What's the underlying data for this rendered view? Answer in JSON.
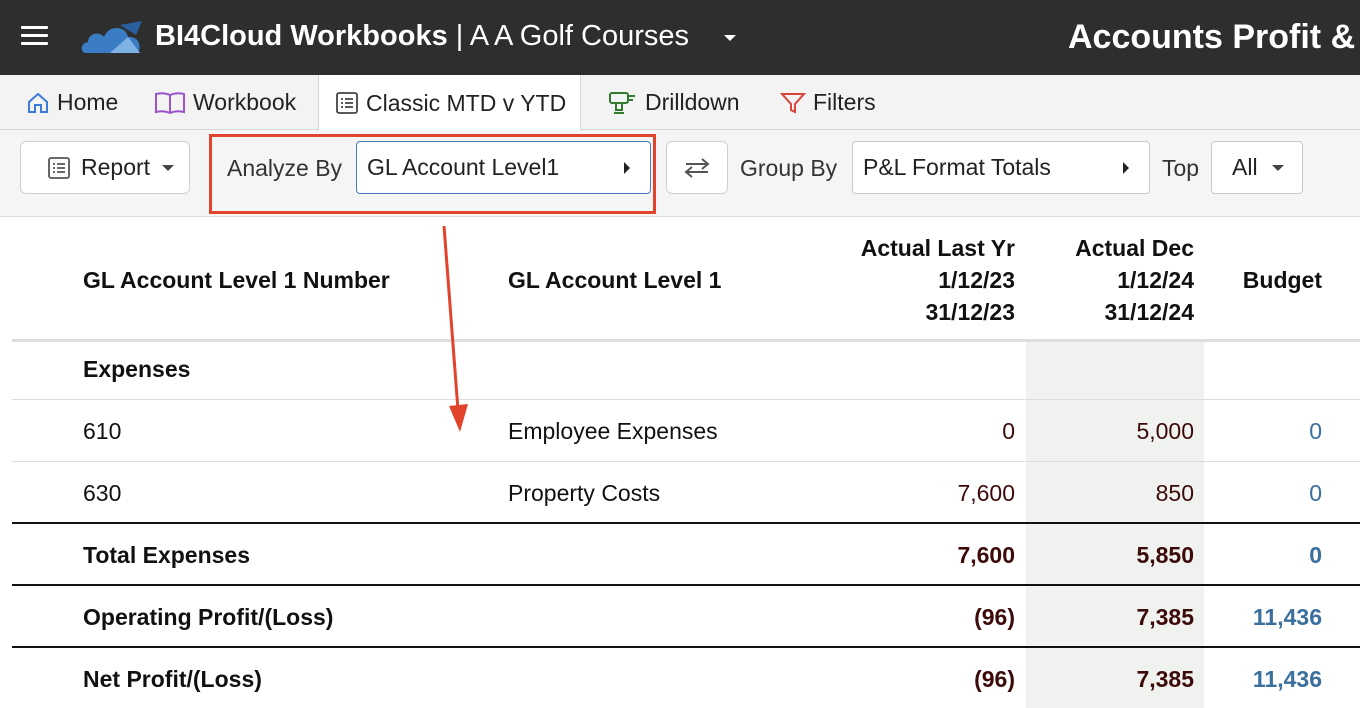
{
  "header": {
    "brand": "BI4Cloud Workbooks",
    "separator": " | ",
    "company": "A A Golf Courses",
    "report_title": "Accounts Profit &"
  },
  "tabs": [
    {
      "label": "Home",
      "icon": "home-icon"
    },
    {
      "label": "Workbook",
      "icon": "book-icon"
    },
    {
      "label": "Classic MTD v YTD",
      "icon": "list-icon"
    },
    {
      "label": "Drilldown",
      "icon": "drill-icon"
    },
    {
      "label": "Filters",
      "icon": "filter-icon"
    }
  ],
  "toolbar": {
    "report_label": "Report",
    "analyze_by_label": "Analyze By",
    "analyze_by_value": "GL Account Level1",
    "group_by_label": "Group By",
    "group_by_value": "P&L Format Totals",
    "top_label": "Top",
    "top_value": "All"
  },
  "table": {
    "headers": {
      "col1": "GL Account Level 1 Number",
      "col2": "GL Account Level 1",
      "col3_line1": "Actual Last Yr",
      "col3_line2": "1/12/23",
      "col3_line3": "31/12/23",
      "col4_line1": "Actual Dec",
      "col4_line2": "1/12/24",
      "col4_line3": "31/12/24",
      "col5": "Budget"
    },
    "rows": [
      {
        "number": "Expenses",
        "name": "",
        "last_yr": "",
        "actual_dec": "",
        "budget": ""
      },
      {
        "number": "610",
        "name": "Employee Expenses",
        "last_yr": "0",
        "actual_dec": "5,000",
        "budget": "0"
      },
      {
        "number": "630",
        "name": "Property Costs",
        "last_yr": "7,600",
        "actual_dec": "850",
        "budget": "0"
      },
      {
        "number": "Total Expenses",
        "name": "",
        "last_yr": "7,600",
        "actual_dec": "5,850",
        "budget": "0"
      },
      {
        "number": "Operating Profit/(Loss)",
        "name": "",
        "last_yr": "(96)",
        "actual_dec": "7,385",
        "budget": "11,436"
      },
      {
        "number": "Net Profit/(Loss)",
        "name": "",
        "last_yr": "(96)",
        "actual_dec": "7,385",
        "budget": "11,436"
      }
    ]
  },
  "colors": {
    "topbar": "#2e2e2e",
    "highlight": "#e2432d",
    "value_brown": "#3d0a0a",
    "value_blue": "#3a6f9e"
  }
}
